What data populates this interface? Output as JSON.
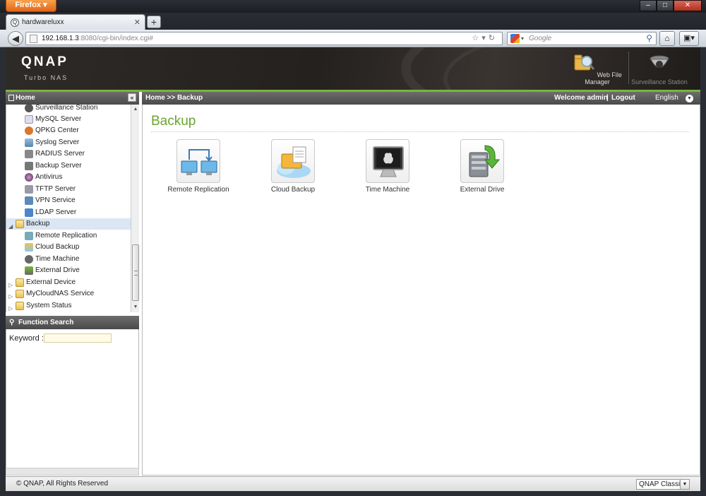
{
  "browser": {
    "menu_button": "Firefox",
    "tab_title": "hardwareluxx",
    "url_host": "192.168.1.3",
    "url_rest": ":8080/cgi-bin/index.cgi#",
    "search_placeholder": "Google"
  },
  "header": {
    "logo": "QNAP",
    "sublogo": "Turbo NAS",
    "apps": [
      {
        "label": "Web File Manager"
      },
      {
        "label": "Surveillance Station"
      }
    ]
  },
  "sidebar": {
    "title": "Home",
    "items": [
      {
        "label": "Surveillance Station"
      },
      {
        "label": "MySQL Server"
      },
      {
        "label": "QPKG Center"
      },
      {
        "label": "Syslog Server"
      },
      {
        "label": "RADIUS Server"
      },
      {
        "label": "Backup Server"
      },
      {
        "label": "Antivirus"
      },
      {
        "label": "TFTP Server"
      },
      {
        "label": "VPN Service"
      },
      {
        "label": "LDAP Server"
      },
      {
        "label": "Backup"
      },
      {
        "label": "Remote Replication"
      },
      {
        "label": "Cloud Backup"
      },
      {
        "label": "Time Machine"
      },
      {
        "label": "External Drive"
      },
      {
        "label": "External Device"
      },
      {
        "label": "MyCloudNAS Service"
      },
      {
        "label": "System Status"
      }
    ]
  },
  "function_search": {
    "title": "Function Search",
    "keyword_label": "Keyword :"
  },
  "topbar": {
    "breadcrumb": "Home >> Backup",
    "welcome": "Welcome admin",
    "separator": "|",
    "logout": "Logout",
    "language": "English"
  },
  "main": {
    "title": "Backup",
    "tiles": [
      {
        "label": "Remote Replication"
      },
      {
        "label": "Cloud Backup"
      },
      {
        "label": "Time Machine"
      },
      {
        "label": "External Drive"
      }
    ]
  },
  "footer": {
    "copyright": "© QNAP, All Rights Reserved",
    "theme": "QNAP Classic"
  }
}
